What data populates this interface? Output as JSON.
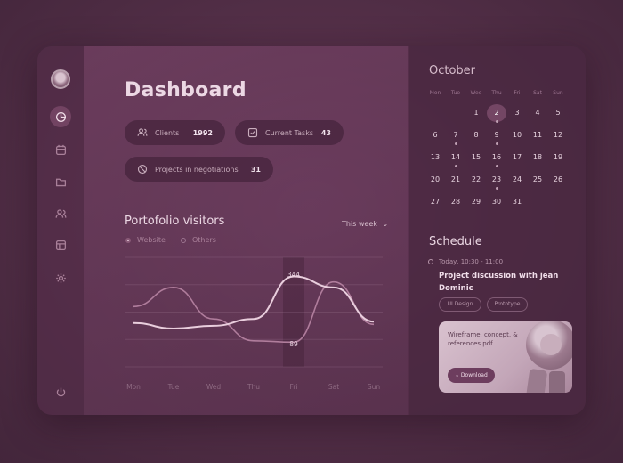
{
  "dashboard": {
    "title": "Dashboard",
    "stats": [
      {
        "label": "Clients",
        "value": "1992"
      },
      {
        "label": "Current Tasks",
        "value": "43"
      },
      {
        "label": "Projects in negotiations",
        "value": "31"
      }
    ]
  },
  "visitors": {
    "title": "Portofolio visitors",
    "period": "This week",
    "legend": [
      "Website",
      "Others"
    ],
    "colors": {
      "website": "#e9cedd",
      "others": "#b07d9c"
    },
    "hover_day": "Fri",
    "hover_values": {
      "high": "344",
      "low": "89"
    }
  },
  "chart_data": {
    "type": "line",
    "categories": [
      "Mon",
      "Tue",
      "Wed",
      "Thu",
      "Fri",
      "Sat",
      "Sun"
    ],
    "series": [
      {
        "name": "Website",
        "values": [
          160,
          140,
          150,
          175,
          330,
          290,
          165
        ]
      },
      {
        "name": "Others",
        "values": [
          220,
          290,
          175,
          95,
          90,
          310,
          155
        ]
      }
    ],
    "ylim": [
      0,
      400
    ],
    "grid": true
  },
  "calendar": {
    "month": "October",
    "weekdays": [
      "Mon",
      "Tue",
      "Wed",
      "Thu",
      "Fri",
      "Sat",
      "Sun"
    ],
    "days": [
      "",
      "",
      "1",
      "2",
      "3",
      "4",
      "5",
      "6",
      "7",
      "8",
      "9",
      "10",
      "11",
      "12",
      "13",
      "14",
      "15",
      "16",
      "17",
      "18",
      "19",
      "20",
      "21",
      "22",
      "23",
      "24",
      "25",
      "26",
      "27",
      "28",
      "29",
      "30",
      "31",
      "",
      ""
    ],
    "today": "2",
    "marked": [
      "2",
      "7",
      "9",
      "14",
      "16",
      "23"
    ]
  },
  "schedule": {
    "title": "Schedule",
    "time": "Today, 10:30 - 11:00",
    "event": "Project discussion with jean Dominic",
    "tags": [
      "UI Design",
      "Prototype"
    ],
    "file": "Wireframe, concept, & references.pdf",
    "download": "↓  Download"
  },
  "sidebar": {
    "items": [
      "chart-icon",
      "calendar-icon",
      "folder-icon",
      "users-icon",
      "board-icon",
      "settings-icon"
    ],
    "logout": "power-icon"
  }
}
